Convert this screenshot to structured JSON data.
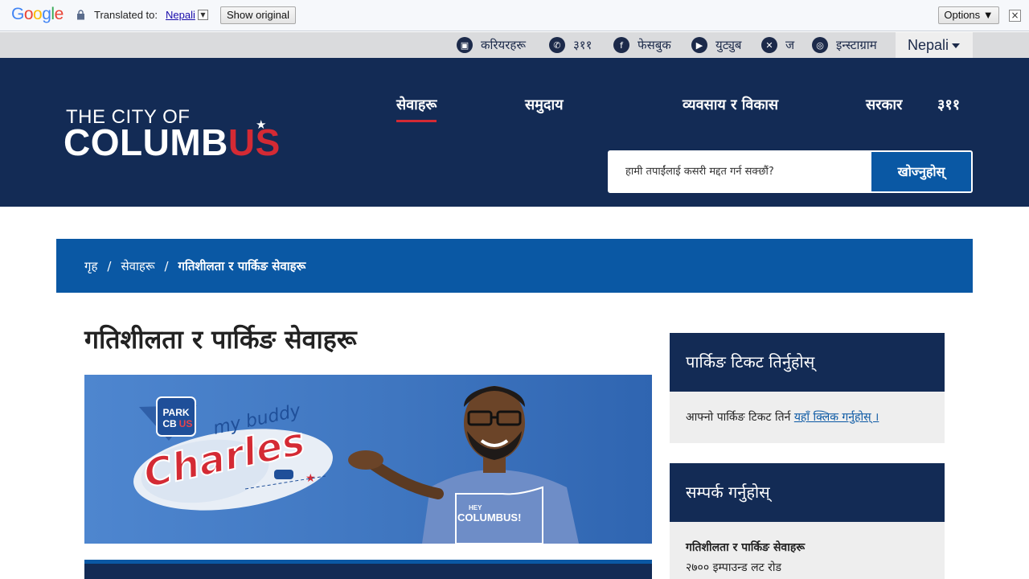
{
  "google_translate": {
    "logo": "Google",
    "translated_to_label": "Translated to:",
    "language": "Nepali",
    "show_original": "Show original",
    "options": "Options ▼"
  },
  "utility_bar": {
    "careers": "करियरहरू",
    "phone": "३११",
    "facebook": "फेसबुक",
    "youtube": "युट्युब",
    "x": "ज",
    "instagram": "इन्स्टाग्राम",
    "language_selected": "Nepali"
  },
  "header": {
    "logo_top": "THE CITY OF",
    "logo_main": "COLUMB",
    "logo_accent": "US",
    "nav": [
      "सेवाहरू",
      "समुदाय",
      "व्यवसाय र विकास",
      "सरकार",
      "३११"
    ],
    "search_placeholder": "हामी तपाईंलाई कसरी मद्दत गर्न सक्छौं?",
    "search_button": "खोज्नुहोस्"
  },
  "breadcrumb": {
    "home": "गृह",
    "services": "सेवाहरू",
    "current": "गतिशीलता र पार्किङ सेवाहरू"
  },
  "main": {
    "title": "गतिशीलता र पार्किङ सेवाहरू",
    "hero": {
      "badge_line1": "PARK",
      "badge_line2": "CB",
      "badge_accent": "US",
      "tagline": "my buddy",
      "name": "Charles",
      "shirt_small": "HEY",
      "shirt_big": "COLUMBUS!"
    }
  },
  "sidebar": {
    "pay_ticket_title": "पार्किङ टिकट तिर्नुहोस्",
    "pay_ticket_text": "आफ्नो पार्किङ टिकट तिर्न ",
    "pay_ticket_link": "यहाँ क्लिक गर्नुहोस् ।",
    "contact_title": "सम्पर्क गर्नुहोस्",
    "contact_name": "गतिशीलता र पार्किङ सेवाहरू",
    "contact_address": "२७०० इम्पाउन्ड लट रोड"
  },
  "colors": {
    "navy": "#132b55",
    "blue": "#0a58a4",
    "red": "#d42a34"
  }
}
